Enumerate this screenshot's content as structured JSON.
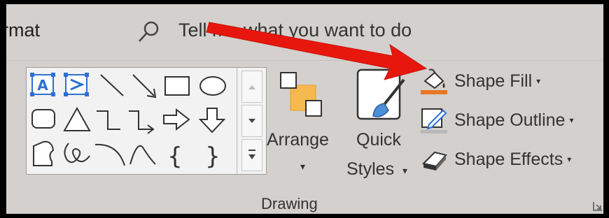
{
  "ribbon": {
    "tab_partial": "rmat",
    "search": {
      "icon": "search-icon",
      "text": "Tell me what you want to do"
    },
    "group": {
      "label": "Drawing",
      "launcher_icon": "dialog-launcher-icon",
      "arrange": {
        "label": "Arrange",
        "caret": "▾",
        "icon": "arrange-icon"
      },
      "quick_styles": {
        "label_line1": "Quick",
        "label_line2": "Styles",
        "caret": "▾",
        "icon": "quick-styles-icon"
      },
      "commands": [
        {
          "label": "Shape Fill",
          "caret": "▾",
          "icon": "paint-bucket-icon",
          "accent": "#e87722"
        },
        {
          "label": "Shape Outline",
          "caret": "▾",
          "icon": "pen-icon",
          "accent": "#b8b8b8"
        },
        {
          "label": "Shape Effects",
          "caret": "▾",
          "icon": "eraser-icon"
        }
      ],
      "shapes_gallery": {
        "rows": [
          [
            "text-box-icon",
            "vertical-text-box-icon",
            "line-icon",
            "arrow-line-icon",
            "rectangle-icon",
            "oval-icon"
          ],
          [
            "rounded-rectangle-icon",
            "triangle-icon",
            "elbow-connector-icon",
            "elbow-arrow-connector-icon",
            "right-arrow-icon",
            "down-arrow-icon"
          ],
          [
            "freeform-icon",
            "scribble-icon",
            "arc-icon",
            "curve-icon",
            "left-brace-icon",
            "right-brace-icon"
          ]
        ],
        "left_brace": "{",
        "right_brace": "}"
      }
    }
  },
  "annotation": {
    "icon": "red-arrow-icon",
    "color": "#e8170d"
  }
}
